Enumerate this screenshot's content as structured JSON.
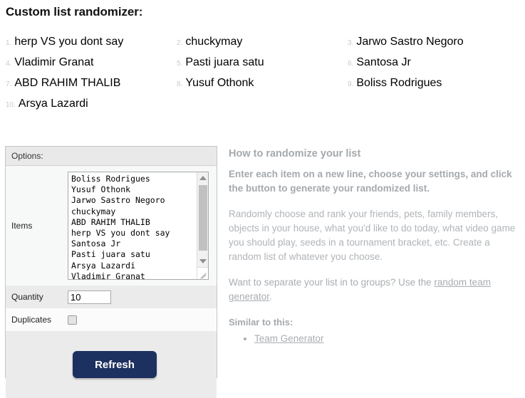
{
  "page": {
    "title": "Custom list randomizer:"
  },
  "results": [
    {
      "num": "1.",
      "text": "herp VS you dont say"
    },
    {
      "num": "2.",
      "text": "chuckymay"
    },
    {
      "num": "3.",
      "text": "Jarwo Sastro Negoro"
    },
    {
      "num": "4.",
      "text": "Vladimir Granat"
    },
    {
      "num": "5.",
      "text": "Pasti juara satu"
    },
    {
      "num": "6.",
      "text": "Santosa Jr"
    },
    {
      "num": "7.",
      "text": "ABD RAHIM THALIB"
    },
    {
      "num": "8.",
      "text": "Yusuf Othonk"
    },
    {
      "num": "9.",
      "text": "Boliss Rodrigues"
    },
    {
      "num": "10.",
      "text": "Arsya Lazardi"
    }
  ],
  "options": {
    "header": "Options:",
    "items_label": "Items",
    "items_value": "Boliss Rodrigues\nYusuf Othonk\nJarwo Sastro Negoro\nchuckymay\nABD RAHIM THALIB\nherp VS you dont say\nSantosa Jr\nPasti juara satu\nArsya Lazardi\nVladimir Granat",
    "quantity_label": "Quantity",
    "quantity_value": "10",
    "duplicates_label": "Duplicates",
    "duplicates_checked": false,
    "refresh_label": "Refresh"
  },
  "help": {
    "heading": "How to randomize your list",
    "lead": "Enter each item on a new line, choose your settings, and click the button to generate your randomized list.",
    "body": "Randomly choose and rank your friends, pets, family members, objects in your house, what you'd like to do today, what video game you should play, seeds in a tournament bracket, etc. Create a random list of whatever you choose.",
    "groups_prefix": "Want to separate your list in to groups? Use the ",
    "groups_link": "random team generator",
    "groups_suffix": ".",
    "similar_heading": "Similar to this:",
    "similar_items": [
      {
        "label": "Team Generator"
      }
    ]
  },
  "colors": {
    "accent": "#1d3160",
    "help_text": "#a9adb1",
    "panel_header": "#e9e9e9",
    "list_number": "#c9c9c9"
  }
}
